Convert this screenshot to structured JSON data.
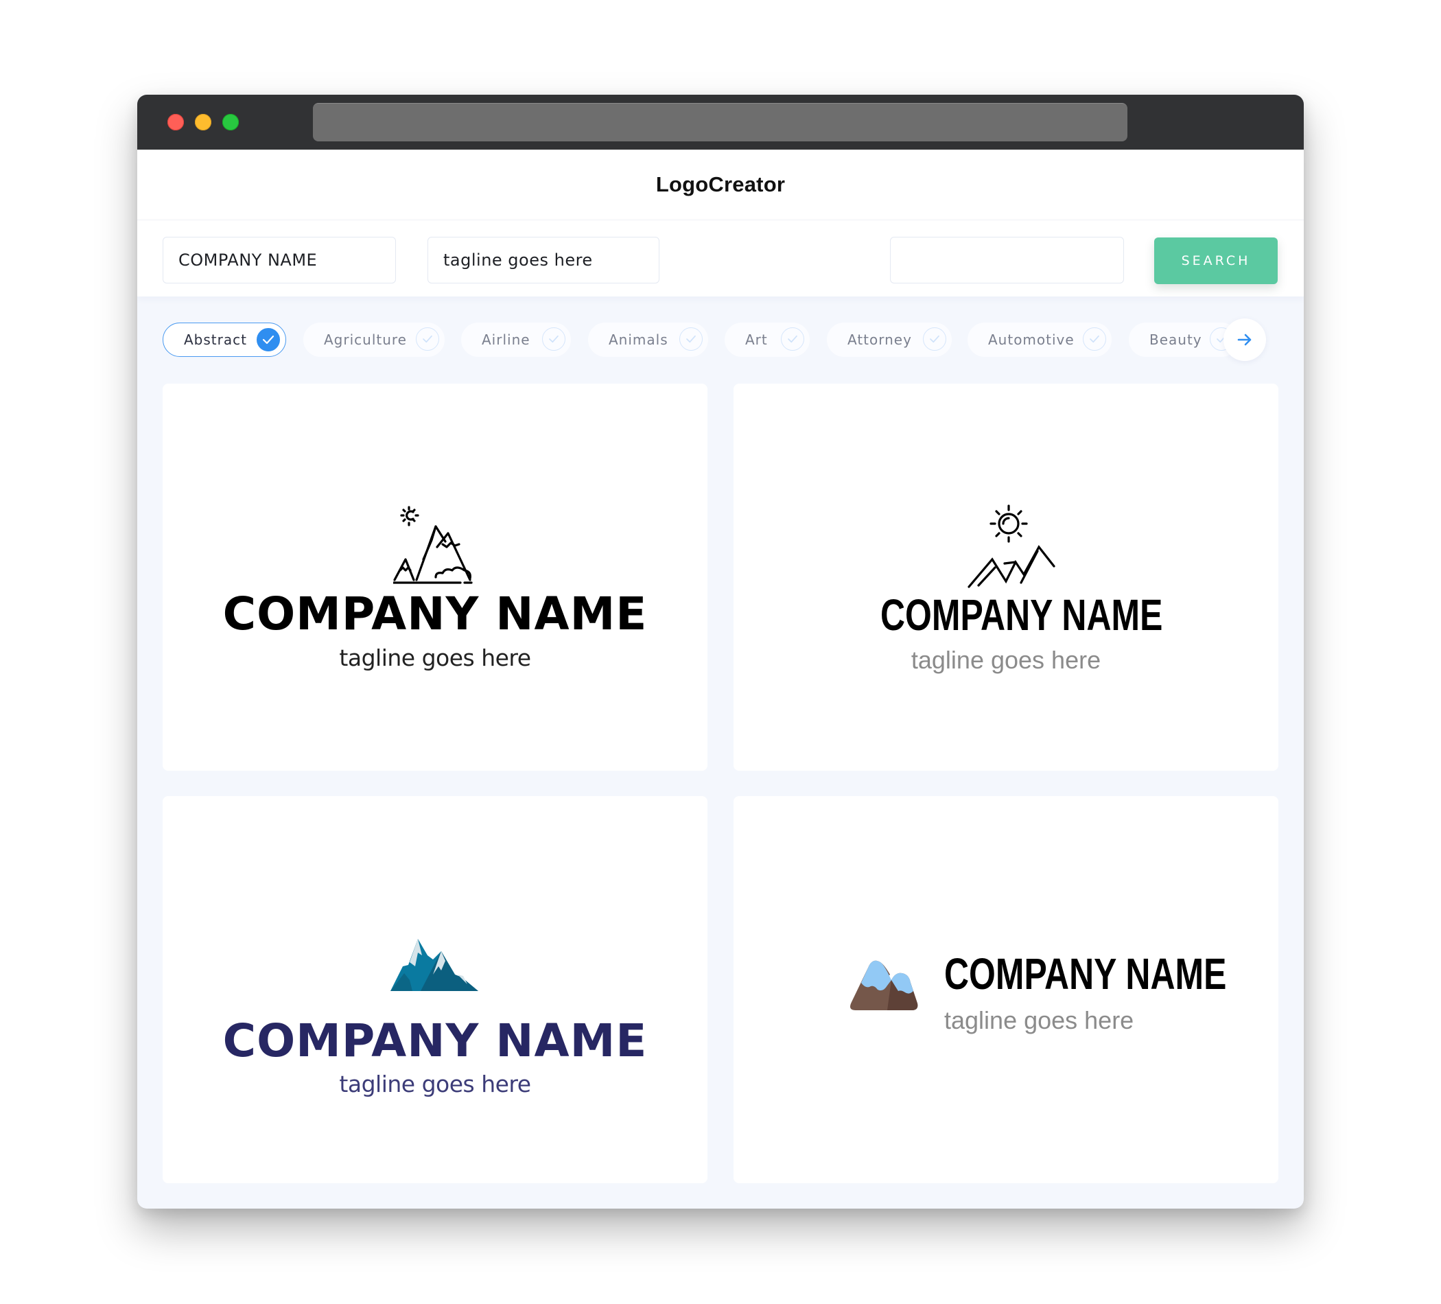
{
  "window": {
    "traffic_lights": [
      "close",
      "minimize",
      "maximize"
    ],
    "address_bar": ""
  },
  "header": {
    "title": "LogoCreator"
  },
  "search": {
    "company_value": "COMPANY NAME",
    "tagline_value": "tagline goes here",
    "query_value": "",
    "button_label": "SEARCH",
    "button_color": "#5bc9a1"
  },
  "categories": {
    "items": [
      {
        "label": "Abstract",
        "selected": true
      },
      {
        "label": "Agriculture",
        "selected": false
      },
      {
        "label": "Airline",
        "selected": false
      },
      {
        "label": "Animals",
        "selected": false
      },
      {
        "label": "Art",
        "selected": false
      },
      {
        "label": "Attorney",
        "selected": false
      },
      {
        "label": "Automotive",
        "selected": false
      },
      {
        "label": "Beauty",
        "selected": false
      }
    ],
    "next_icon": "arrow-right-icon",
    "accent_color": "#2f8ef0"
  },
  "logos": [
    {
      "name": "COMPANY NAME",
      "tagline": "tagline goes here",
      "icon": "line-mountains-sun-icon",
      "name_color": "#000000",
      "tagline_color": "#222222"
    },
    {
      "name": "COMPANY NAME",
      "tagline": "tagline goes here",
      "icon": "line-peaks-sun-icon",
      "name_color": "#000000",
      "tagline_color": "#8b8b8b"
    },
    {
      "name": "COMPANY NAME",
      "tagline": "tagline goes here",
      "icon": "teal-snowy-mountains-icon",
      "name_color": "#272763",
      "tagline_color": "#3c3c78"
    },
    {
      "name": "COMPANY NAME",
      "tagline": "tagline goes here",
      "icon": "brown-blue-mountains-icon",
      "name_color": "#000000",
      "tagline_color": "#8b8b8b"
    }
  ]
}
